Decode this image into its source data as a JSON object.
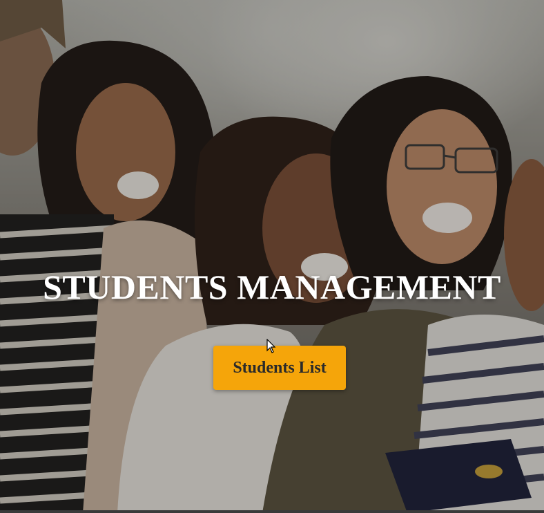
{
  "hero": {
    "background_image": "students-group-photo",
    "title": "STUDENTS MANAGEMENT",
    "button_label": "Students List"
  },
  "colors": {
    "button_background": "#f5a50a",
    "button_text": "#2a2a2a",
    "title_text": "#ffffff"
  },
  "icons": {
    "cursor": "mouse-pointer-icon"
  }
}
